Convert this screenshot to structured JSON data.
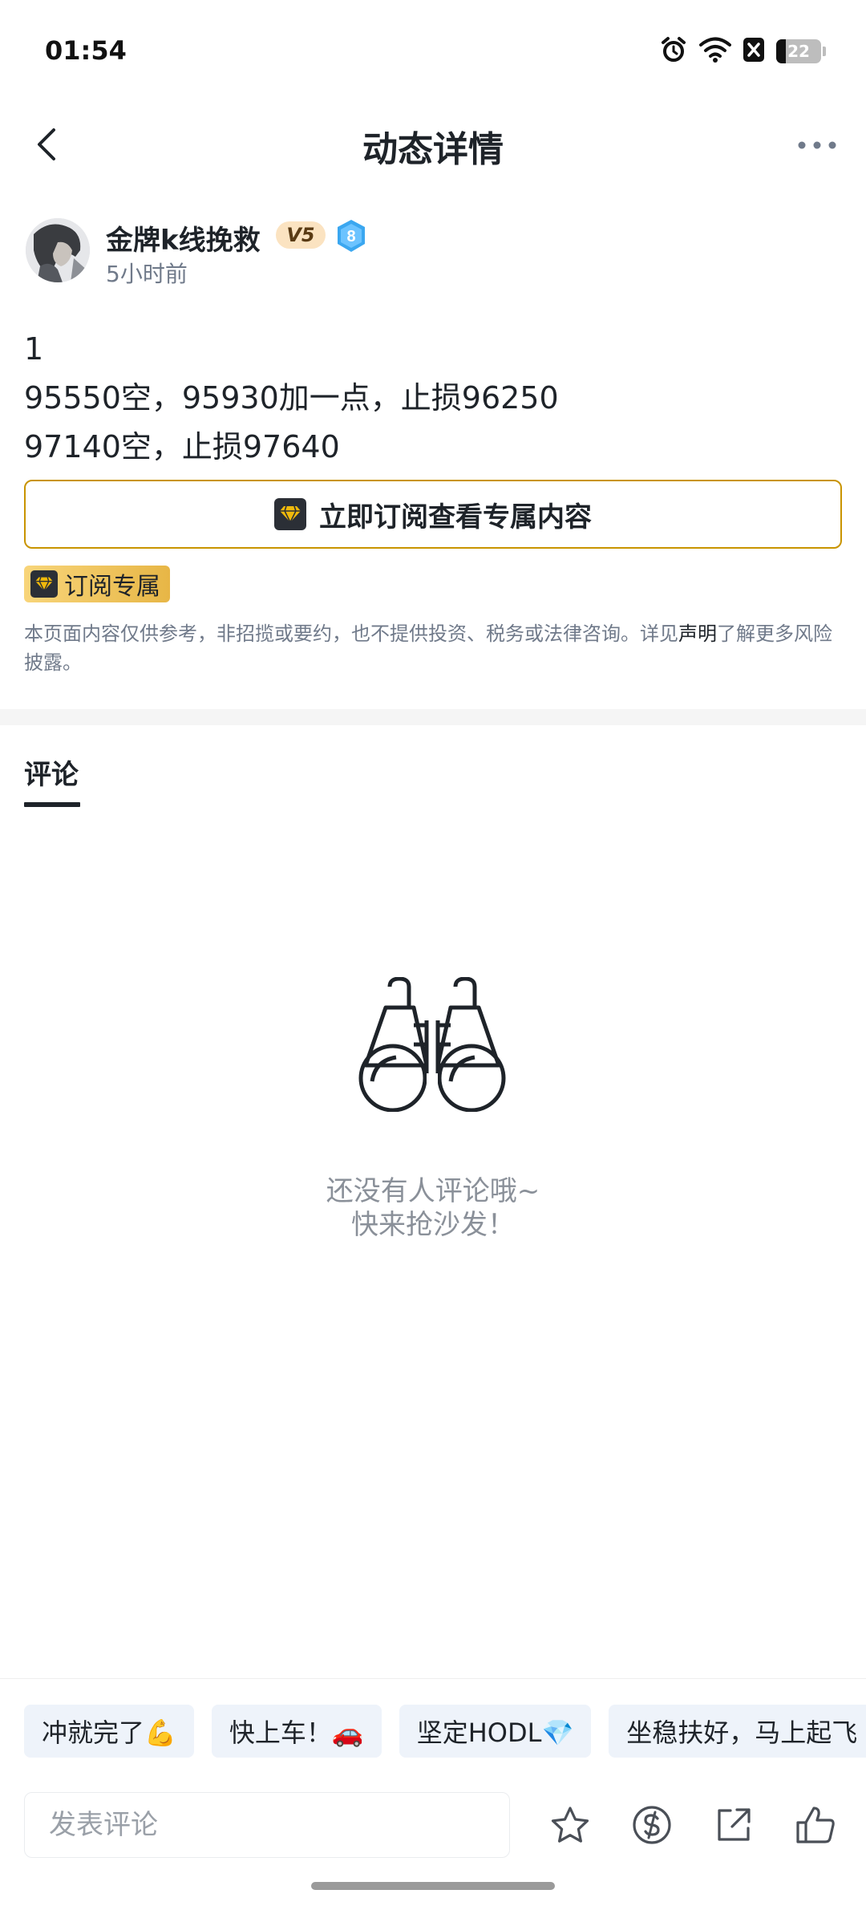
{
  "status_bar": {
    "time": "01:54",
    "battery_level": "22",
    "icons": [
      "alarm-icon",
      "wifi-icon",
      "x-app-icon",
      "battery-icon"
    ]
  },
  "nav": {
    "title": "动态详情",
    "back_icon": "chevron-left-icon",
    "more_icon": "more-horizontal-icon"
  },
  "author": {
    "name": "金牌k线挽救",
    "vip_level": "V5",
    "badge_level": "8",
    "posted_ago": "5小时前"
  },
  "post": {
    "lines": [
      "1",
      "95550空，95930加一点，止损96250",
      "97140空，止损97640"
    ]
  },
  "subscribe": {
    "button_label": "立即订阅查看专属内容",
    "tag_label": "订阅专属"
  },
  "disclaimer": {
    "text_before": "本页面内容仅供参考，非招揽或要约，也不提供投资、税务或法律咨询。详见",
    "link_text": "声明",
    "text_after": "了解更多风险披露。"
  },
  "comments": {
    "tab_label": "评论",
    "empty_line1": "还没有人评论哦~",
    "empty_line2": "快来抢沙发！",
    "empty_icon": "binoculars-icon"
  },
  "quick_replies": [
    "冲就完了💪",
    "快上车！🚗",
    "坚定HODL💎",
    "坐稳扶好，马上起飞"
  ],
  "bottom_bar": {
    "comment_placeholder": "发表评论",
    "actions": [
      "star-icon",
      "tip-coin-icon",
      "share-icon",
      "like-icon"
    ]
  },
  "colors": {
    "accent_gold": "#c99400",
    "text_primary": "#1e2329",
    "text_secondary": "#707a8a",
    "chip_bg": "#eef3fa",
    "level_badge_blue": "#3ba7f0"
  }
}
